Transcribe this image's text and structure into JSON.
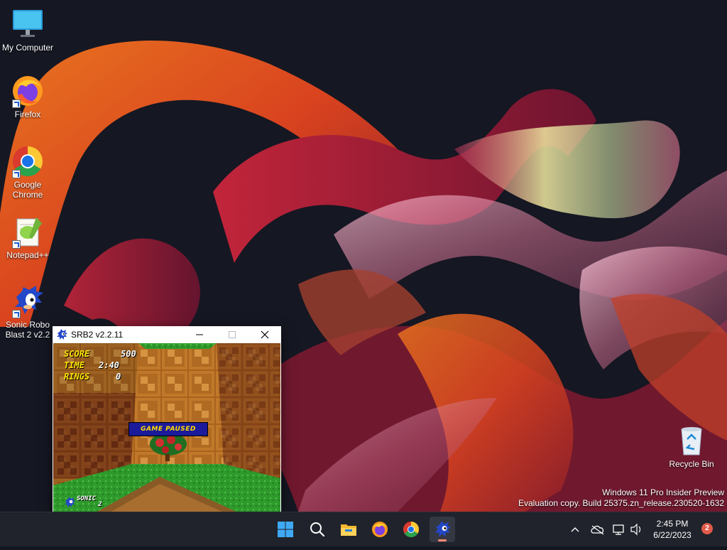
{
  "desktop": {
    "icons": [
      {
        "label": "My Computer",
        "icon": "monitor-icon"
      },
      {
        "label": "Firefox",
        "icon": "firefox-icon"
      },
      {
        "label": "Google Chrome",
        "icon": "chrome-icon"
      },
      {
        "label": "Notepad++",
        "icon": "notepadpp-icon"
      },
      {
        "label": "Sonic Robo Blast 2 v2.2",
        "icon": "sonic-icon"
      },
      {
        "label": "Recycle Bin",
        "icon": "recycle-bin-icon"
      }
    ],
    "watermark": {
      "line1": "Windows 11 Pro Insider Preview",
      "line2": "Evaluation copy. Build 25375.zn_release.230520-1632"
    }
  },
  "game_window": {
    "title": "SRB2 v2.2.11",
    "controls": [
      "minimize",
      "maximize",
      "close"
    ],
    "hud": {
      "score_label": "SCORE",
      "score_value": "500",
      "time_label": "TIME",
      "time_value": "2:40",
      "rings_label": "RINGS",
      "rings_value": "0",
      "lives_name": "SONIC",
      "lives_count": "2"
    },
    "pause_text": "GAME PAUSED"
  },
  "taskbar": {
    "apps": [
      "windows-start",
      "search",
      "file-explorer",
      "firefox",
      "chrome",
      "sonic-robo-blast-2"
    ],
    "active_app": "sonic-robo-blast-2",
    "tray": {
      "time": "2:45 PM",
      "date": "6/22/2023",
      "notification_count": "2"
    }
  },
  "colors": {
    "taskbar_bg": "#20232b",
    "hud_yellow": "#ffe400",
    "pause_banner_bg": "#1a1a9a",
    "notification_badge": "#e05a4a"
  }
}
